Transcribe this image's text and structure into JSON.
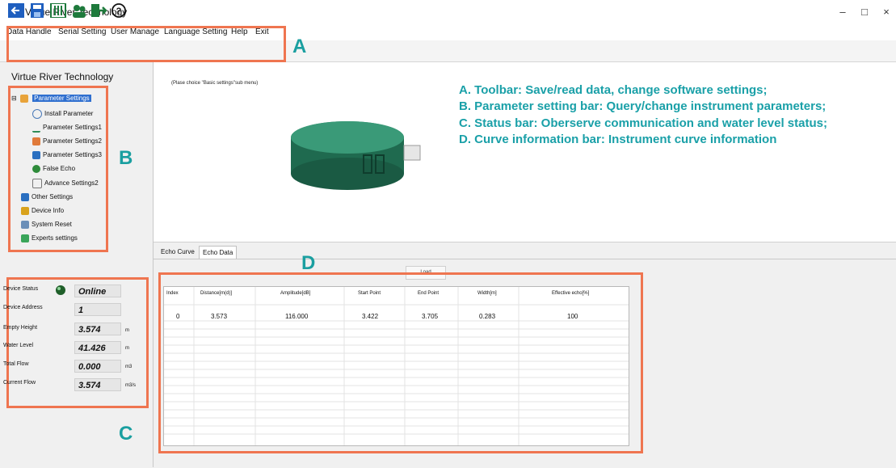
{
  "window": {
    "title": "Virtue River Technology",
    "controls": [
      "–",
      "□",
      "×"
    ]
  },
  "menu": [
    "Data Handle",
    "Serial Setting",
    "User Manage",
    "Language Setting",
    "Help",
    "Exit"
  ],
  "toolbar_icons": [
    "back-icon",
    "save-icon",
    "settings-sliders-icon",
    "users-icon",
    "exit-icon",
    "help-icon"
  ],
  "left_panel": {
    "title": "Virtue River Technology",
    "tree": {
      "root": "Parameter Settings",
      "children": [
        "Install Parameter",
        "Parameter Settings1",
        "Parameter Settings2",
        "Parameter Settings3",
        "False Echo",
        "Advance Settings2"
      ],
      "siblings": [
        "Other Settings",
        "Device Info",
        "System Reset",
        "Experts settings"
      ]
    }
  },
  "status": {
    "device_status_label": "Device Status",
    "device_status_value": "Online",
    "rows": [
      {
        "label": "Device Address",
        "value": "1",
        "unit": ""
      },
      {
        "label": "Empty Height",
        "value": "3.574",
        "unit": "m"
      },
      {
        "label": "Water Level",
        "value": "41.426",
        "unit": "m"
      },
      {
        "label": "Total Flow",
        "value": "0.000",
        "unit": "m3"
      },
      {
        "label": "Current Flow",
        "value": "3.574",
        "unit": "m3/s"
      }
    ]
  },
  "main": {
    "hint": "(Plase choice \"Basic settings\"sub menu)",
    "legend": [
      "A. Toolbar: Save/read data, change software settings;",
      "B. Parameter setting bar: Query/change instrument parameters;",
      "C. Status bar: Oberserve communication and water level status;",
      "D. Curve information bar: Instrument curve information"
    ],
    "tabs": [
      "Echo Curve",
      "Echo Data"
    ],
    "load_label": "Load",
    "table": {
      "headers": [
        "Index",
        "Distance[m(d)]",
        "Amplitude[dB]",
        "Start Point",
        "End Point",
        "Width[m]",
        "Effective echo[%]"
      ],
      "rows": [
        [
          "0",
          "3.573",
          "116.000",
          "3.422",
          "3.705",
          "0.283",
          "100"
        ]
      ]
    }
  },
  "labels": {
    "A": "A",
    "B": "B",
    "C": "C",
    "D": "D"
  },
  "colors": {
    "annotation_box": "#ef7550",
    "annotation_text": "#1aa0a8",
    "selected": "#2f6fcf",
    "online_led": "#2e7d32"
  }
}
